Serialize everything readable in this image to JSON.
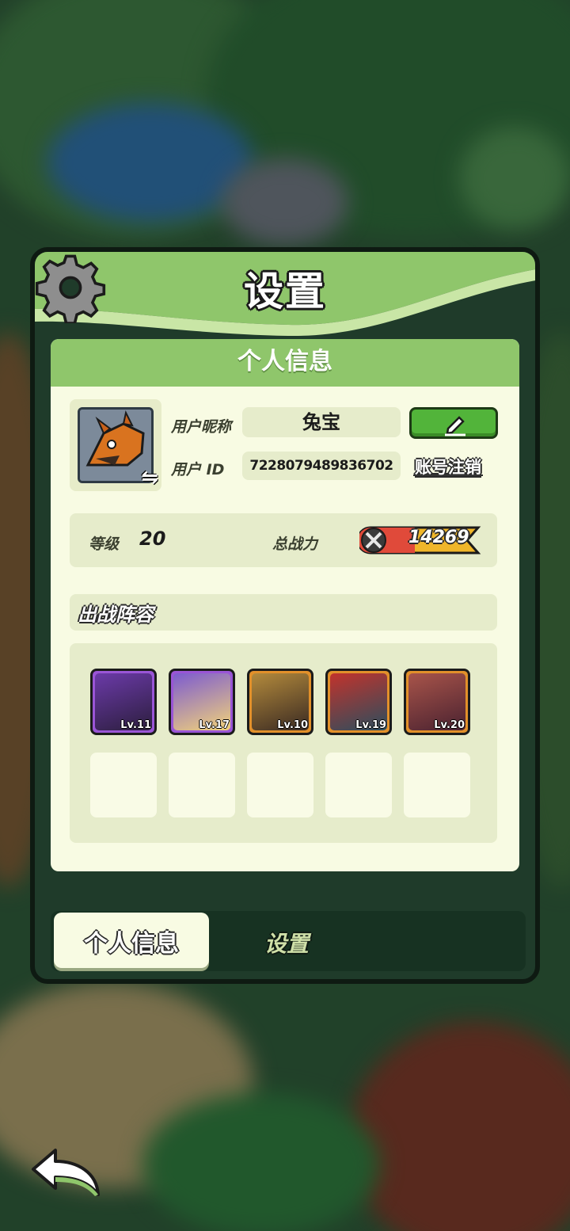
{
  "dialog": {
    "title": "设置",
    "card_title": "个人信息"
  },
  "profile": {
    "nickname_label": "用户昵称",
    "nickname": "兔宝",
    "id_label": "用户 ID",
    "user_id": "7228079489836702",
    "deregister_label": "账号注销",
    "edit_icon": "pencil-icon",
    "swap_icon": "swap-arrows-icon"
  },
  "stats": {
    "level_label": "等级",
    "level": "20",
    "power_label": "总战力",
    "power": "14269"
  },
  "lineup": {
    "title": "出战阵容",
    "heroes": [
      {
        "lv": "Lv.11",
        "frame": "purple"
      },
      {
        "lv": "Lv.17",
        "frame": "purple"
      },
      {
        "lv": "Lv.10",
        "frame": "gold"
      },
      {
        "lv": "Lv.19",
        "frame": "gold"
      },
      {
        "lv": "Lv.20",
        "frame": "gold"
      }
    ]
  },
  "tabs": {
    "personal": "个人信息",
    "settings": "设置"
  },
  "colors": {
    "header_green": "#8fc66b",
    "card_bg": "#f8fbe3",
    "edit_button": "#52b43a",
    "purple_frame": "#9a55d6",
    "gold_frame": "#e2902a"
  }
}
